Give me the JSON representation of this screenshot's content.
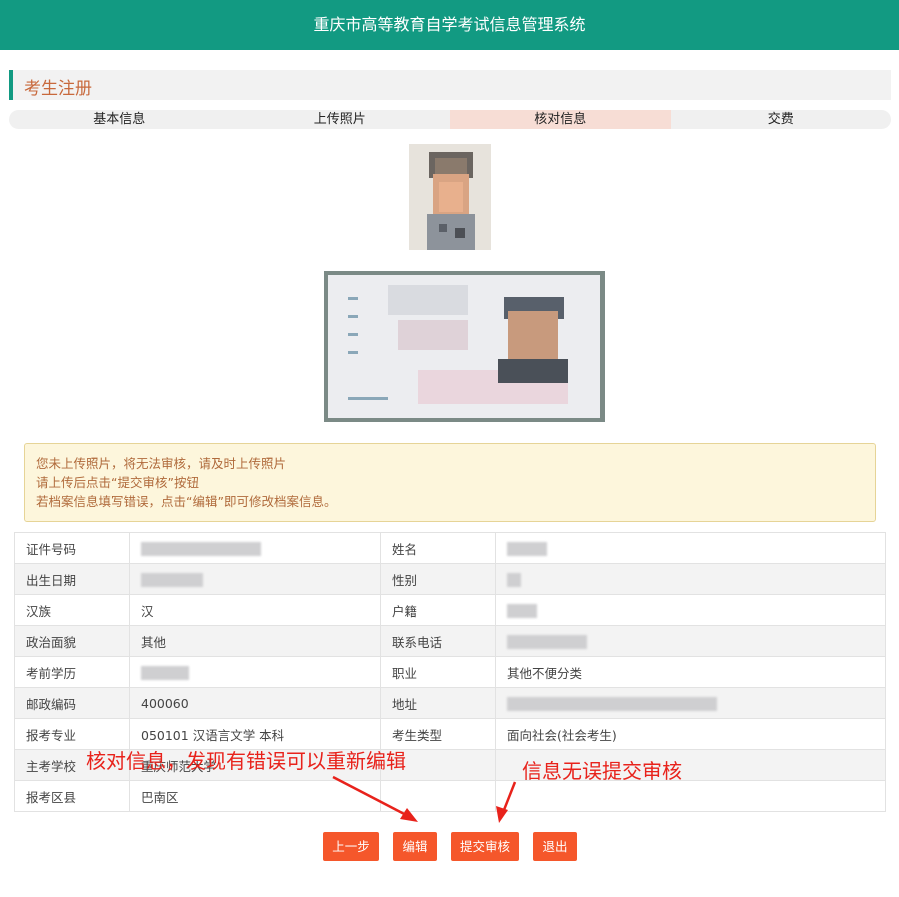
{
  "header": {
    "title": "重庆市高等教育自学考试信息管理系统"
  },
  "section": {
    "title": "考生注册"
  },
  "steps": [
    "基本信息",
    "上传照片",
    "核对信息",
    "交费"
  ],
  "active_step": 2,
  "notice": [
    "您未上传照片，将无法审核，请及时上传照片",
    "请上传后点击“提交审核”按钮",
    "若档案信息填写错误，点击“编辑”即可修改档案信息。"
  ],
  "table": {
    "rows": [
      {
        "k1": "证件号码",
        "v1": "",
        "k2": "姓名",
        "v2": ""
      },
      {
        "k1": "出生日期",
        "v1": "",
        "k2": "性别",
        "v2": ""
      },
      {
        "k1": "汉族",
        "v1": "汉",
        "k2": "户籍",
        "v2": ""
      },
      {
        "k1": "政治面貌",
        "v1": "其他",
        "k2": "联系电话",
        "v2": ""
      },
      {
        "k1": "考前学历",
        "v1": "",
        "k2": "职业",
        "v2": "其他不便分类"
      },
      {
        "k1": "邮政编码",
        "v1": "400060",
        "k2": "地址",
        "v2": ""
      },
      {
        "k1": "报考专业",
        "v1": "050101 汉语言文学 本科",
        "k2": "考生类型",
        "v2": "面向社会(社会考生)"
      },
      {
        "k1": "主考学校",
        "v1": "重庆师范大学",
        "k2": "",
        "v2": ""
      },
      {
        "k1": "报考区县",
        "v1": "巴南区",
        "k2": "",
        "v2": ""
      }
    ]
  },
  "buttons": {
    "prev": "上一步",
    "edit": "编辑",
    "submit": "提交审核",
    "exit": "退出"
  },
  "annotations": {
    "left": "核对信息，发现有错误可以重新编辑",
    "right": "信息无误提交审核"
  },
  "colors": {
    "header": "#129a82",
    "button": "#f5572b",
    "annotation": "#e8221b",
    "notice_text": "#b06a3b"
  }
}
